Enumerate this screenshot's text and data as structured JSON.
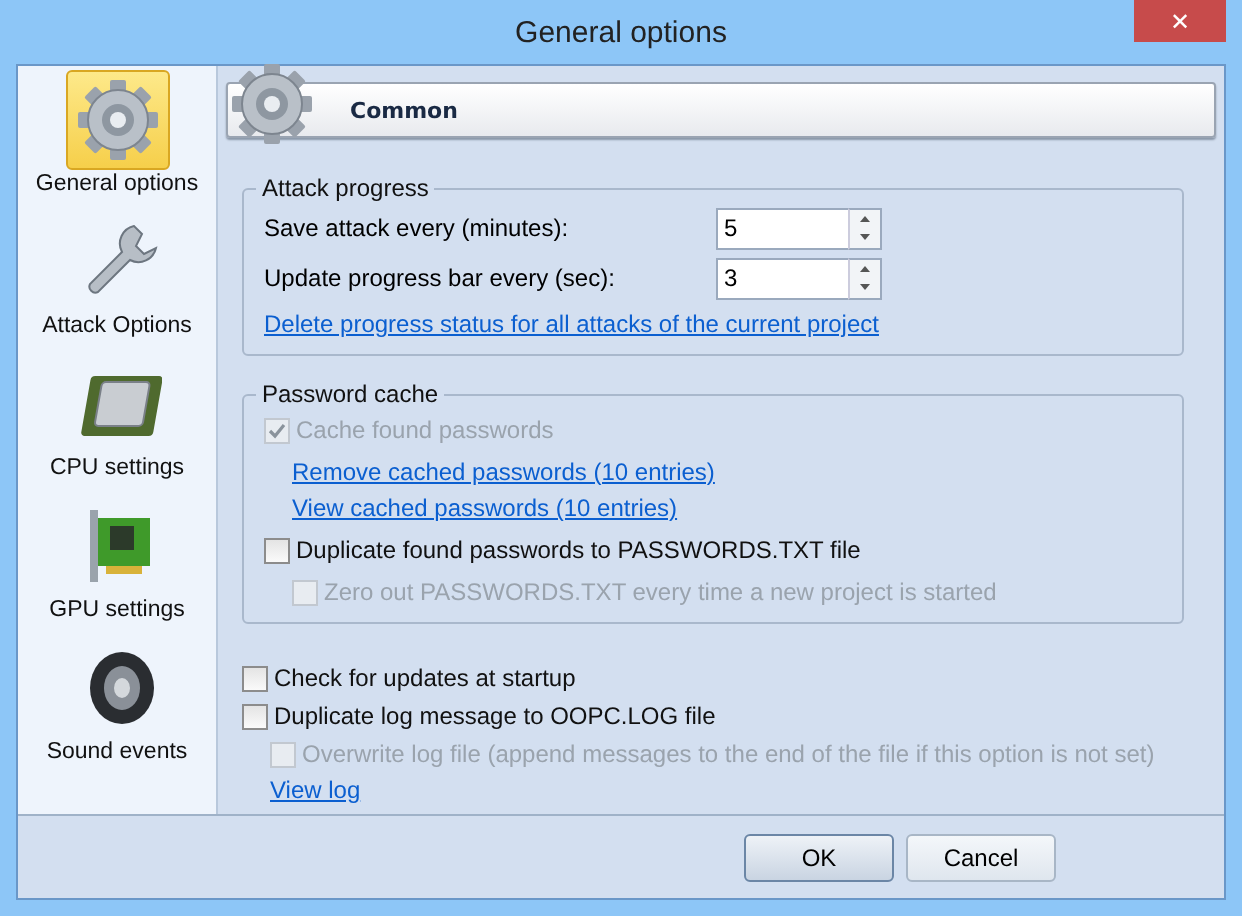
{
  "window": {
    "title": "General options",
    "close": "✕"
  },
  "sidebar": {
    "items": [
      {
        "label": "General options",
        "selected": true
      },
      {
        "label": "Attack Options",
        "selected": false
      },
      {
        "label": "CPU settings",
        "selected": false
      },
      {
        "label": "GPU settings",
        "selected": false
      },
      {
        "label": "Sound events",
        "selected": false
      }
    ]
  },
  "header": {
    "title": "Common"
  },
  "attack_progress": {
    "title": "Attack progress",
    "fields": [
      {
        "label": "Save attack every (minutes):",
        "value": "5"
      },
      {
        "label": "Update progress bar every (sec):",
        "value": "3"
      }
    ],
    "link": "Delete progress status for all attacks of the current project"
  },
  "password_cache": {
    "title": "Password cache",
    "items": [
      {
        "kind": "checkbox",
        "label": "Cache found passwords",
        "checked": true,
        "disabled": true,
        "children": [
          {
            "kind": "link",
            "label": "Remove cached passwords (10 entries)"
          },
          {
            "kind": "link",
            "label": "View cached passwords  (10 entries)"
          }
        ]
      },
      {
        "kind": "checkbox",
        "label": "Duplicate found passwords to PASSWORDS.TXT file",
        "checked": false,
        "disabled": false,
        "children": [
          {
            "kind": "checkbox",
            "label": "Zero out PASSWORDS.TXT every time a new project is started",
            "checked": false,
            "disabled": true
          }
        ]
      }
    ]
  },
  "options": {
    "items": [
      {
        "kind": "checkbox",
        "label": "Check for updates at startup",
        "checked": false,
        "disabled": false
      },
      {
        "kind": "checkbox",
        "label": "Duplicate log message to OOPC.LOG file",
        "checked": false,
        "disabled": false,
        "children": [
          {
            "kind": "checkbox",
            "label": "Overwrite log file (append messages to the end of the file if this option is not set)",
            "checked": false,
            "disabled": true
          },
          {
            "kind": "link",
            "label": "View log"
          }
        ]
      }
    ]
  },
  "buttons": [
    {
      "label": "OK",
      "default": true
    },
    {
      "label": "Cancel",
      "default": false
    }
  ]
}
